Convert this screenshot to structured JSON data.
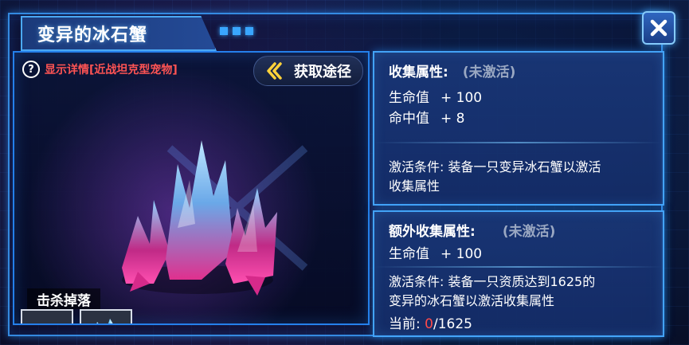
{
  "window": {
    "title": "变异的冰石蟹",
    "close_label": "✕"
  },
  "left_panel": {
    "detail_text": "显示详情[近战坦克型宠物]",
    "source_button_label": "获取途径",
    "drop_label": "击杀掉落",
    "drops": [
      {
        "icon": "meat-icon"
      },
      {
        "icon": "ice-crystal-icon"
      }
    ]
  },
  "collection_attributes": {
    "title": "收集属性:",
    "state": "(未激活)",
    "stats": [
      {
        "name": "生命值",
        "value": "+ 100"
      },
      {
        "name": "命中值",
        "value": "+ 8"
      }
    ],
    "condition_line1": "激活条件: 装备一只变异冰石蟹以激活",
    "condition_line2": "收集属性"
  },
  "extra_collection_attributes": {
    "title": "额外收集属性:",
    "state": "(未激活)",
    "stats": [
      {
        "name": "生命值",
        "value": "+ 100"
      }
    ],
    "condition_line1": "激活条件: 装备一只资质达到1625的",
    "condition_line2": "变异的冰石蟹以激活收集属性",
    "current_label": "当前:",
    "current_value": "0",
    "current_total": "/1625"
  },
  "colors": {
    "accent_blue": "#39a6ff",
    "detail_red": "#ff5454",
    "inactive_gray": "#9aa8c2",
    "progress_red": "#ff4a4a"
  }
}
